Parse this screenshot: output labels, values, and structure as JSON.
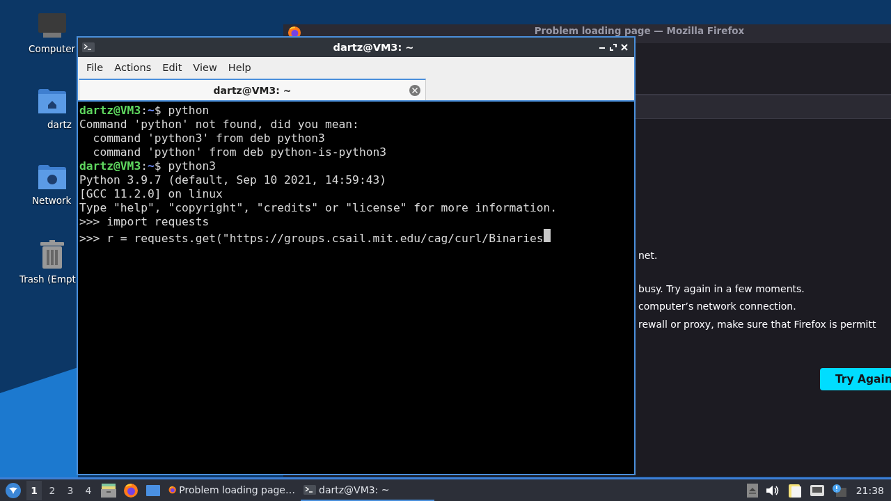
{
  "desktop": {
    "icons": [
      {
        "kind": "computer",
        "label": "Computer"
      },
      {
        "kind": "home",
        "label": "dartz"
      },
      {
        "kind": "network",
        "label": "Network"
      },
      {
        "kind": "trash",
        "label": "Trash (Empt"
      }
    ]
  },
  "browser_window": {
    "title": "Problem loading page — Mozilla Firefox",
    "paragraphs": [
      [
        "net."
      ],
      [
        "busy. Try again in a few moments.",
        "computer’s network connection.",
        "rewall or proxy, make sure that Firefox is permitt"
      ]
    ],
    "button": "Try Again"
  },
  "terminal_window": {
    "title": "dartz@VM3: ~",
    "menu": [
      "File",
      "Actions",
      "Edit",
      "View",
      "Help"
    ],
    "tabs": [
      {
        "label": "dartz@VM3: ~",
        "selected": true
      }
    ],
    "lines": [
      {
        "kind": "prompt",
        "user": "dartz@VM3",
        "sep": ":",
        "path": "~",
        "command": "$ python"
      },
      {
        "kind": "output",
        "text": "Command 'python' not found, did you mean:"
      },
      {
        "kind": "output",
        "text": "  command 'python3' from deb python3"
      },
      {
        "kind": "output",
        "text": "  command 'python' from deb python-is-python3"
      },
      {
        "kind": "prompt",
        "user": "dartz@VM3",
        "sep": ":",
        "path": "~",
        "command": "$ python3"
      },
      {
        "kind": "output",
        "text": "Python 3.9.7 (default, Sep 10 2021, 14:59:43)"
      },
      {
        "kind": "output",
        "text": "[GCC 11.2.0] on linux"
      },
      {
        "kind": "output",
        "text": "Type \"help\", \"copyright\", \"credits\" or \"license\" for more information."
      },
      {
        "kind": "output",
        "text": ">>> import requests"
      },
      {
        "kind": "output",
        "text": ">>> r = requests.get(\"https://groups.csail.mit.edu/cag/curl/Binaries",
        "cursor": true
      }
    ]
  },
  "taskbar": {
    "workspaces": [
      {
        "label": "1",
        "selected": true
      },
      {
        "label": "2",
        "selected": false
      },
      {
        "label": "3",
        "selected": false
      },
      {
        "label": "4",
        "selected": false
      }
    ],
    "tasks": [
      {
        "kind": "browser",
        "label": "Problem loading page…",
        "selected": false
      },
      {
        "kind": "terminal",
        "label": "dartz@VM3: ~",
        "selected": true
      }
    ],
    "clock": "21:38"
  }
}
